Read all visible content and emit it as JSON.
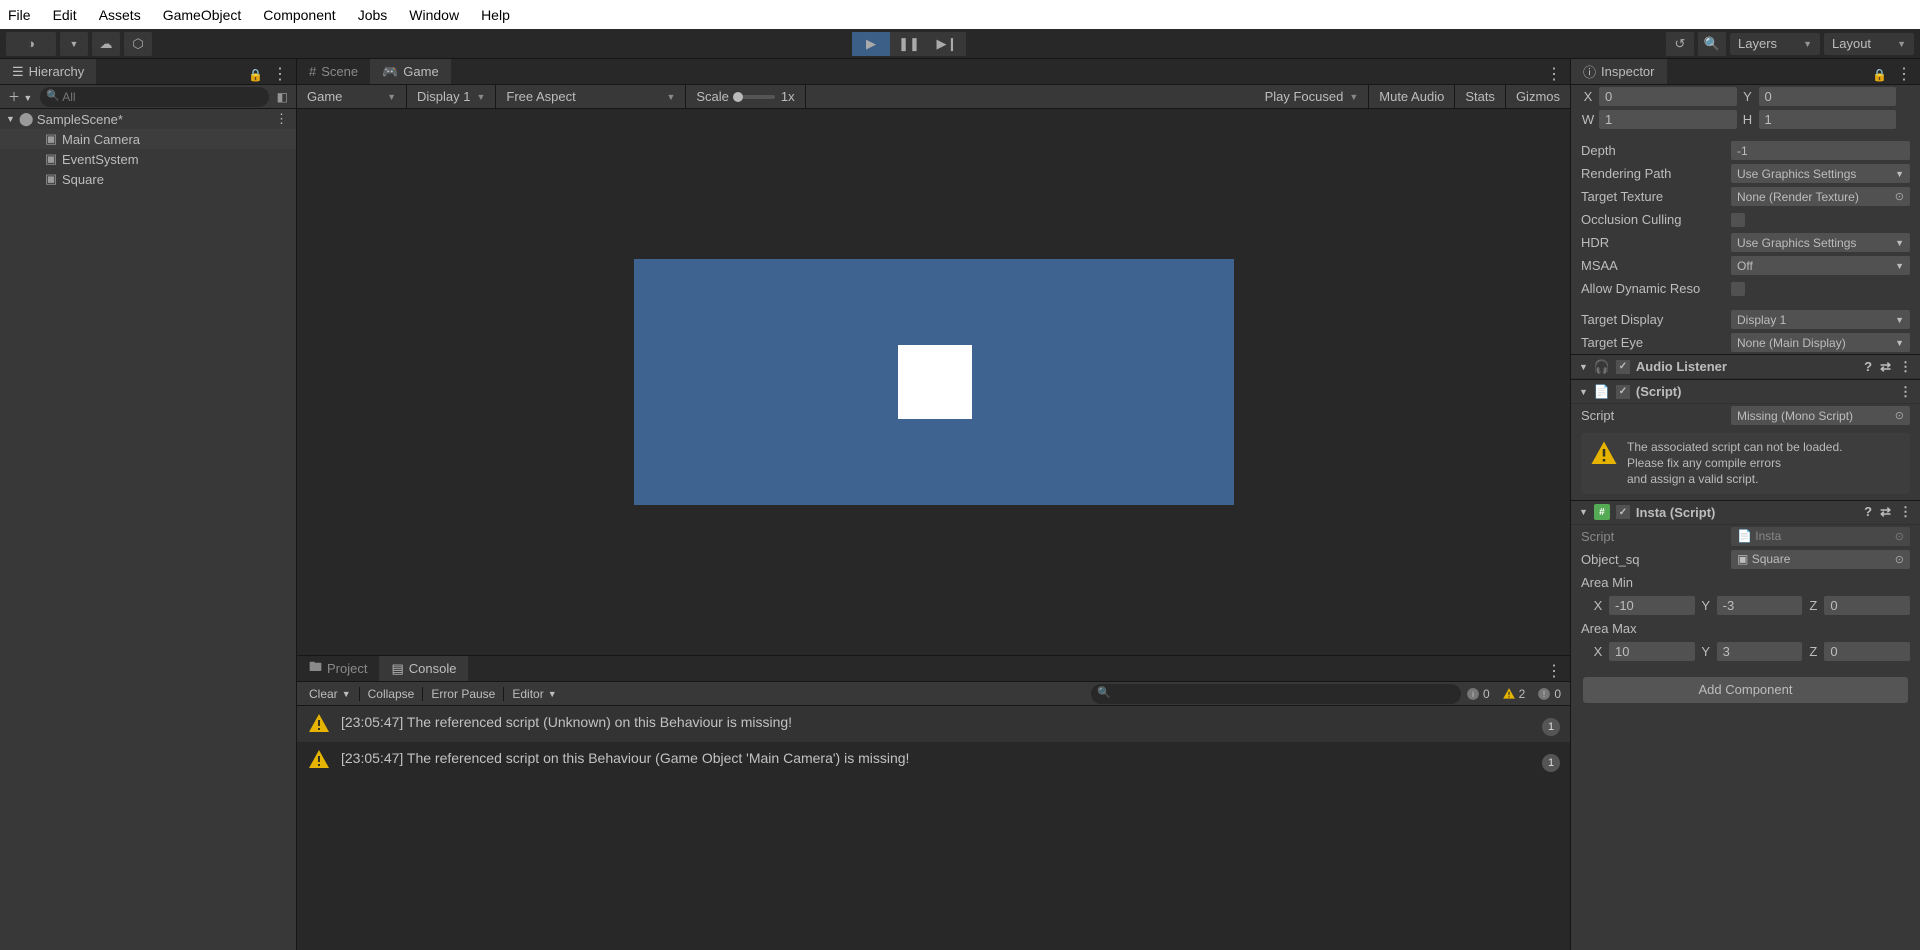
{
  "menu": {
    "items": [
      "File",
      "Edit",
      "Assets",
      "GameObject",
      "Component",
      "Jobs",
      "Window",
      "Help"
    ]
  },
  "topbar": {
    "layers_label": "Layers",
    "layout_label": "Layout"
  },
  "hierarchy": {
    "title": "Hierarchy",
    "search_placeholder": "All",
    "scene": "SampleScene*",
    "items": [
      "Main Camera",
      "EventSystem",
      "Square"
    ]
  },
  "center_tabs": {
    "scene": "Scene",
    "game": "Game"
  },
  "game_toolbar": {
    "game": "Game",
    "display": "Display 1",
    "aspect": "Free Aspect",
    "scale_label": "Scale",
    "scale_value": "1x",
    "focus": "Play Focused",
    "mute": "Mute Audio",
    "stats": "Stats",
    "gizmos": "Gizmos"
  },
  "project_tabs": {
    "project": "Project",
    "console": "Console"
  },
  "console_toolbar": {
    "clear": "Clear",
    "collapse": "Collapse",
    "error_pause": "Error Pause",
    "editor": "Editor",
    "counts": {
      "info": "0",
      "warn": "2",
      "err": "0"
    }
  },
  "console_entries": [
    {
      "text": "[23:05:47] The referenced script (Unknown) on this Behaviour is missing!",
      "count": "1"
    },
    {
      "text": "[23:05:47] The referenced script on this Behaviour (Game Object 'Main Camera') is missing!",
      "count": "1"
    }
  ],
  "inspector": {
    "title": "Inspector",
    "rect": {
      "x_lbl": "X",
      "x": "0",
      "y_lbl": "Y",
      "y": "0",
      "w_lbl": "W",
      "w": "1",
      "h_lbl": "H",
      "h": "1"
    },
    "props": [
      {
        "label": "Depth",
        "value": "-1",
        "kind": "num"
      },
      {
        "label": "Rendering Path",
        "value": "Use Graphics Settings",
        "kind": "dd"
      },
      {
        "label": "Target Texture",
        "value": "None (Render Texture)",
        "kind": "obj"
      },
      {
        "label": "Occlusion Culling",
        "value": "",
        "kind": "chk"
      },
      {
        "label": "HDR",
        "value": "Use Graphics Settings",
        "kind": "dd"
      },
      {
        "label": "MSAA",
        "value": "Off",
        "kind": "dd"
      },
      {
        "label": "Allow Dynamic Reso",
        "value": "",
        "kind": "chk"
      },
      {
        "label": "Target Display",
        "value": "Display 1",
        "kind": "dd"
      },
      {
        "label": "Target Eye",
        "value": "None (Main Display)",
        "kind": "dd"
      }
    ],
    "audio_listener": {
      "title": "Audio Listener"
    },
    "missing_script": {
      "title": "(Script)",
      "script_label": "Script",
      "script_value": "Missing (Mono Script)",
      "warning_l1": "The associated script can not be loaded.",
      "warning_l2": "Please fix any compile errors",
      "warning_l3": "and assign a valid script."
    },
    "insta": {
      "title": "Insta (Script)",
      "script_label": "Script",
      "script_value": "Insta",
      "object_label": "Object_sq",
      "object_value": "Square",
      "area_min_label": "Area Min",
      "area_min": {
        "x": "-10",
        "y": "-3",
        "z": "0"
      },
      "area_max_label": "Area Max",
      "area_max": {
        "x": "10",
        "y": "3",
        "z": "0"
      }
    },
    "add_component": "Add Component"
  }
}
